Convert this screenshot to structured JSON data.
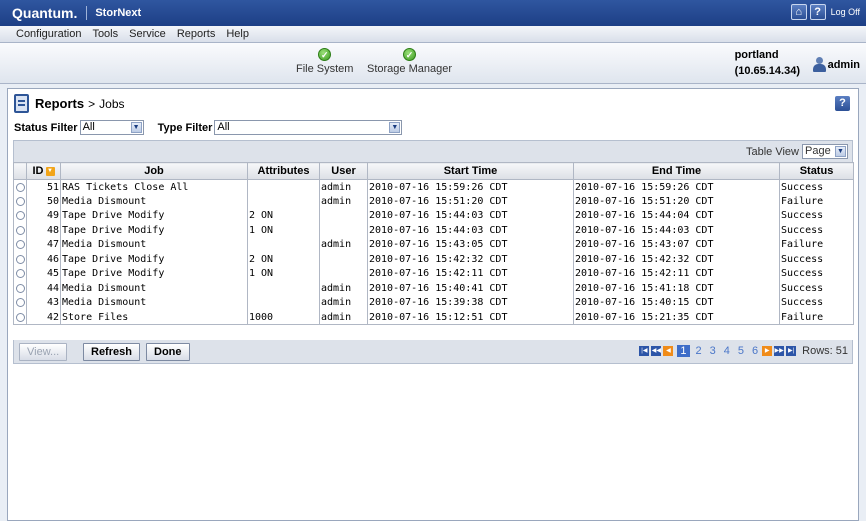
{
  "header": {
    "brand": "Quantum.",
    "product": "StorNext",
    "home_glyph": "⌂",
    "help_glyph": "?",
    "logoff_label": "Log Off"
  },
  "menu": [
    "Configuration",
    "Tools",
    "Service",
    "Reports",
    "Help"
  ],
  "status": {
    "services": [
      {
        "label": "File System",
        "state": "ok",
        "glyph": "✓"
      },
      {
        "label": "Storage Manager",
        "state": "ok",
        "glyph": "✓"
      }
    ],
    "hostname": "portland",
    "ip": "(10.65.14.34)",
    "user": "admin"
  },
  "page": {
    "title": "Reports",
    "breadcrumb_sep": ">",
    "subtitle": "Jobs",
    "help_glyph": "?"
  },
  "filters": {
    "status_label": "Status Filter",
    "status_value": "All",
    "type_label": "Type Filter",
    "type_value": "All"
  },
  "table_view": {
    "label": "Table View",
    "value": "Page"
  },
  "table": {
    "columns": [
      "ID",
      "Job",
      "Attributes",
      "User",
      "Start Time",
      "End Time",
      "Status"
    ],
    "rows": [
      {
        "id": "51",
        "job": "RAS Tickets Close All",
        "attributes": "",
        "user": "admin",
        "start": "2010-07-16 15:59:26 CDT",
        "end": "2010-07-16 15:59:26 CDT",
        "status": "Success"
      },
      {
        "id": "50",
        "job": "Media Dismount",
        "attributes": "",
        "user": "admin",
        "start": "2010-07-16 15:51:20 CDT",
        "end": "2010-07-16 15:51:20 CDT",
        "status": "Failure"
      },
      {
        "id": "49",
        "job": "Tape Drive Modify",
        "attributes": "2 ON",
        "user": "",
        "start": "2010-07-16 15:44:03 CDT",
        "end": "2010-07-16 15:44:04 CDT",
        "status": "Success"
      },
      {
        "id": "48",
        "job": "Tape Drive Modify",
        "attributes": "1 ON",
        "user": "",
        "start": "2010-07-16 15:44:03 CDT",
        "end": "2010-07-16 15:44:03 CDT",
        "status": "Success"
      },
      {
        "id": "47",
        "job": "Media Dismount",
        "attributes": "",
        "user": "admin",
        "start": "2010-07-16 15:43:05 CDT",
        "end": "2010-07-16 15:43:07 CDT",
        "status": "Failure"
      },
      {
        "id": "46",
        "job": "Tape Drive Modify",
        "attributes": "2 ON",
        "user": "",
        "start": "2010-07-16 15:42:32 CDT",
        "end": "2010-07-16 15:42:32 CDT",
        "status": "Success"
      },
      {
        "id": "45",
        "job": "Tape Drive Modify",
        "attributes": "1 ON",
        "user": "",
        "start": "2010-07-16 15:42:11 CDT",
        "end": "2010-07-16 15:42:11 CDT",
        "status": "Success"
      },
      {
        "id": "44",
        "job": "Media Dismount",
        "attributes": "",
        "user": "admin",
        "start": "2010-07-16 15:40:41 CDT",
        "end": "2010-07-16 15:41:18 CDT",
        "status": "Success"
      },
      {
        "id": "43",
        "job": "Media Dismount",
        "attributes": "",
        "user": "admin",
        "start": "2010-07-16 15:39:38 CDT",
        "end": "2010-07-16 15:40:15 CDT",
        "status": "Success"
      },
      {
        "id": "42",
        "job": "Store Files",
        "attributes": "1000",
        "user": "admin",
        "start": "2010-07-16 15:12:51 CDT",
        "end": "2010-07-16 15:21:35 CDT",
        "status": "Failure"
      }
    ]
  },
  "actions": {
    "view_label": "View...",
    "refresh_label": "Refresh",
    "done_label": "Done"
  },
  "pager": {
    "pages": [
      "1",
      "2",
      "3",
      "4",
      "5",
      "6"
    ],
    "current": "1",
    "rows_text": "Rows: 51"
  }
}
